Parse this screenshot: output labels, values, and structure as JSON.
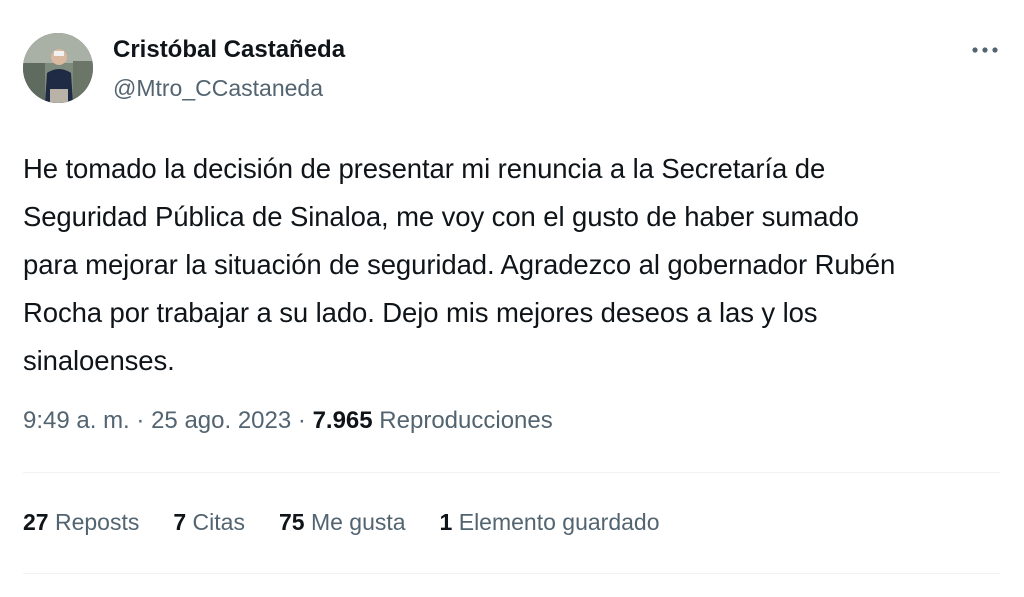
{
  "author": {
    "display_name": "Cristóbal Castañeda",
    "handle": "@Mtro_CCastaneda"
  },
  "tweet": {
    "text": "He tomado la decisión de presentar mi renuncia a la Secretaría de\nSeguridad Pública de Sinaloa, me voy con el gusto de haber sumado\npara mejorar la situación de seguridad. Agradezco al gobernador Rubén\nRocha por trabajar a su lado. Dejo mis mejores deseos a las y los\nsinaloenses.",
    "time": "9:49 a. m.",
    "separator": "·",
    "date": "25 ago. 2023",
    "views_count": "7.965",
    "views_label": "Reproducciones"
  },
  "stats": [
    {
      "count": "27",
      "label": "Reposts"
    },
    {
      "count": "7",
      "label": "Citas"
    },
    {
      "count": "75",
      "label": "Me gusta"
    },
    {
      "count": "1",
      "label": "Elemento guardado"
    }
  ],
  "icons": {
    "more": "more-horizontal-icon",
    "avatar": "profile-photo"
  },
  "colors": {
    "text_primary": "#0f1419",
    "text_secondary": "#536471",
    "divider": "#eff3f4"
  }
}
